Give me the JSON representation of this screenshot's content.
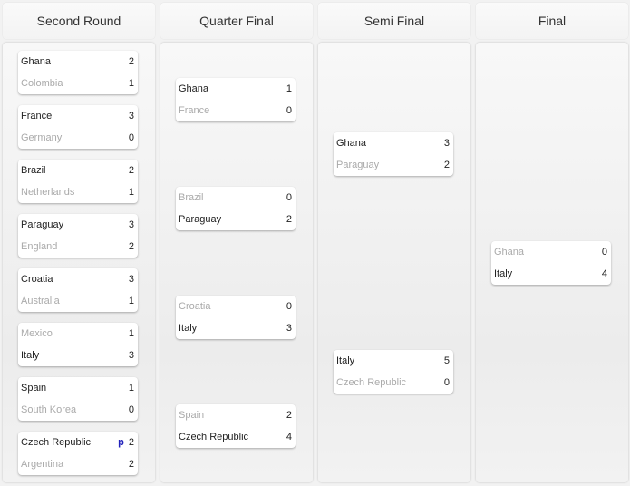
{
  "rounds": [
    {
      "title": "Second Round",
      "matches": [
        {
          "teams": [
            {
              "name": "Ghana",
              "score": "2",
              "win": true
            },
            {
              "name": "Colombia",
              "score": "1",
              "win": false
            }
          ]
        },
        {
          "teams": [
            {
              "name": "France",
              "score": "3",
              "win": true
            },
            {
              "name": "Germany",
              "score": "0",
              "win": false
            }
          ]
        },
        {
          "teams": [
            {
              "name": "Brazil",
              "score": "2",
              "win": true
            },
            {
              "name": "Netherlands",
              "score": "1",
              "win": false
            }
          ]
        },
        {
          "teams": [
            {
              "name": "Paraguay",
              "score": "3",
              "win": true
            },
            {
              "name": "England",
              "score": "2",
              "win": false
            }
          ]
        },
        {
          "teams": [
            {
              "name": "Croatia",
              "score": "3",
              "win": true
            },
            {
              "name": "Australia",
              "score": "1",
              "win": false
            }
          ]
        },
        {
          "teams": [
            {
              "name": "Mexico",
              "score": "1",
              "win": false
            },
            {
              "name": "Italy",
              "score": "3",
              "win": true
            }
          ]
        },
        {
          "teams": [
            {
              "name": "Spain",
              "score": "1",
              "win": true
            },
            {
              "name": "South Korea",
              "score": "0",
              "win": false
            }
          ]
        },
        {
          "teams": [
            {
              "name": "Czech Republic",
              "score": "2",
              "win": true,
              "marker": "p"
            },
            {
              "name": "Argentina",
              "score": "2",
              "win": false
            }
          ]
        }
      ]
    },
    {
      "title": "Quarter Final",
      "matches": [
        {
          "teams": [
            {
              "name": "Ghana",
              "score": "1",
              "win": true
            },
            {
              "name": "France",
              "score": "0",
              "win": false
            }
          ]
        },
        {
          "teams": [
            {
              "name": "Brazil",
              "score": "0",
              "win": false
            },
            {
              "name": "Paraguay",
              "score": "2",
              "win": true
            }
          ]
        },
        {
          "teams": [
            {
              "name": "Croatia",
              "score": "0",
              "win": false
            },
            {
              "name": "Italy",
              "score": "3",
              "win": true
            }
          ]
        },
        {
          "teams": [
            {
              "name": "Spain",
              "score": "2",
              "win": false
            },
            {
              "name": "Czech Republic",
              "score": "4",
              "win": true
            }
          ]
        }
      ]
    },
    {
      "title": "Semi Final",
      "matches": [
        {
          "teams": [
            {
              "name": "Ghana",
              "score": "3",
              "win": true
            },
            {
              "name": "Paraguay",
              "score": "2",
              "win": false
            }
          ]
        },
        {
          "teams": [
            {
              "name": "Italy",
              "score": "5",
              "win": true
            },
            {
              "name": "Czech Republic",
              "score": "0",
              "win": false
            }
          ]
        }
      ]
    },
    {
      "title": "Final",
      "matches": [
        {
          "teams": [
            {
              "name": "Ghana",
              "score": "0",
              "win": false
            },
            {
              "name": "Italy",
              "score": "4",
              "win": true
            }
          ]
        }
      ]
    }
  ],
  "colors": {
    "winner": "#222222",
    "loser": "#aaaaaa",
    "penalty_marker": "#2222bb"
  }
}
